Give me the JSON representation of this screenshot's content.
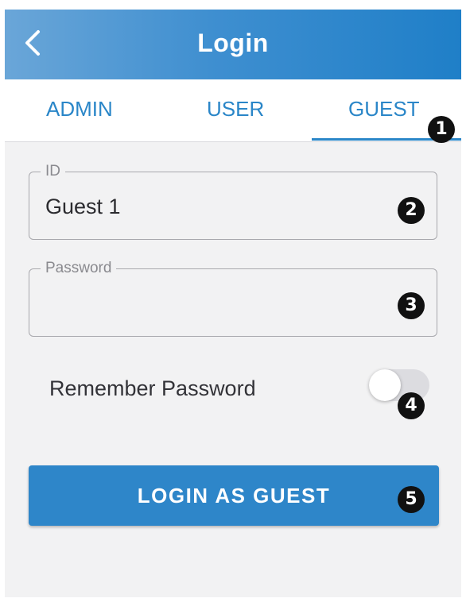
{
  "header": {
    "title": "Login",
    "back_icon": "chevron-left-icon"
  },
  "tabs": [
    {
      "label": "ADMIN",
      "selected": false
    },
    {
      "label": "USER",
      "selected": false
    },
    {
      "label": "GUEST",
      "selected": true
    }
  ],
  "form": {
    "id_field": {
      "label": "ID",
      "value": "Guest 1"
    },
    "password_field": {
      "label": "Password",
      "value": ""
    },
    "remember_password": {
      "label": "Remember Password",
      "enabled": false
    },
    "submit_label": "LOGIN AS GUEST"
  },
  "callouts": [
    "1",
    "2",
    "3",
    "4",
    "5"
  ],
  "colors": {
    "accent": "#2E86C9",
    "header_gradient_start": "#6AA6D8",
    "header_gradient_end": "#1F7FC8",
    "background": "#F2F2F3",
    "callout": "#111111"
  }
}
